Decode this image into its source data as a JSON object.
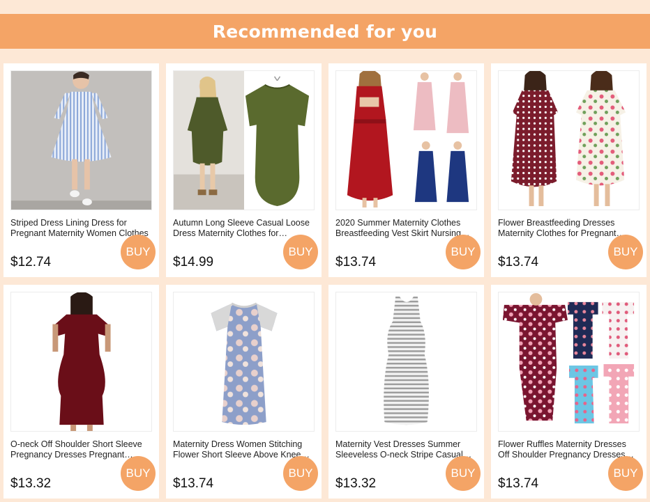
{
  "header": {
    "title": "Recommended for you"
  },
  "buy_label": "BUY",
  "colors": {
    "background": "#fde8d6",
    "accent": "#f4a466",
    "card": "#ffffff"
  },
  "products": [
    {
      "title": "Striped Dress Lining Dress for Pregnant Maternity Women Clothes",
      "price": "$12.74",
      "image": "blue-striped-shirt-dress"
    },
    {
      "title": "Autumn Long Sleeve Casual Loose Dress Maternity Clothes for Pregnant Women",
      "price": "$14.99",
      "image": "olive-green-pocket-dress"
    },
    {
      "title": "2020 Summer Maternity Clothes Breastfeeding Vest Skirt Nursing Dress",
      "price": "$13.74",
      "image": "red-pink-navy-nursing-dresses"
    },
    {
      "title": "Flower Breastfeeding Dresses Maternity Clothes for Pregnant Women",
      "price": "$13.74",
      "image": "polka-dot-and-floral-wrap-dresses"
    },
    {
      "title": "O-neck Off Shoulder Short Sleeve Pregnancy Dresses Pregnant Women Clothes",
      "price": "$13.32",
      "image": "burgundy-cold-shoulder-dress"
    },
    {
      "title": "Maternity Dress Women Stitching Flower Short Sleeve Above Knee Dress",
      "price": "$13.74",
      "image": "floral-raglan-dress"
    },
    {
      "title": "Maternity Vest Dresses Summer Sleeveless O-neck Stripe Casual Dress",
      "price": "$13.32",
      "image": "grey-striped-tank-dress"
    },
    {
      "title": "Flower Ruffles Maternity Dresses Off Shoulder Pregnancy Dresses Photo Props",
      "price": "$13.74",
      "image": "floral-ruffle-off-shoulder-dresses"
    }
  ]
}
